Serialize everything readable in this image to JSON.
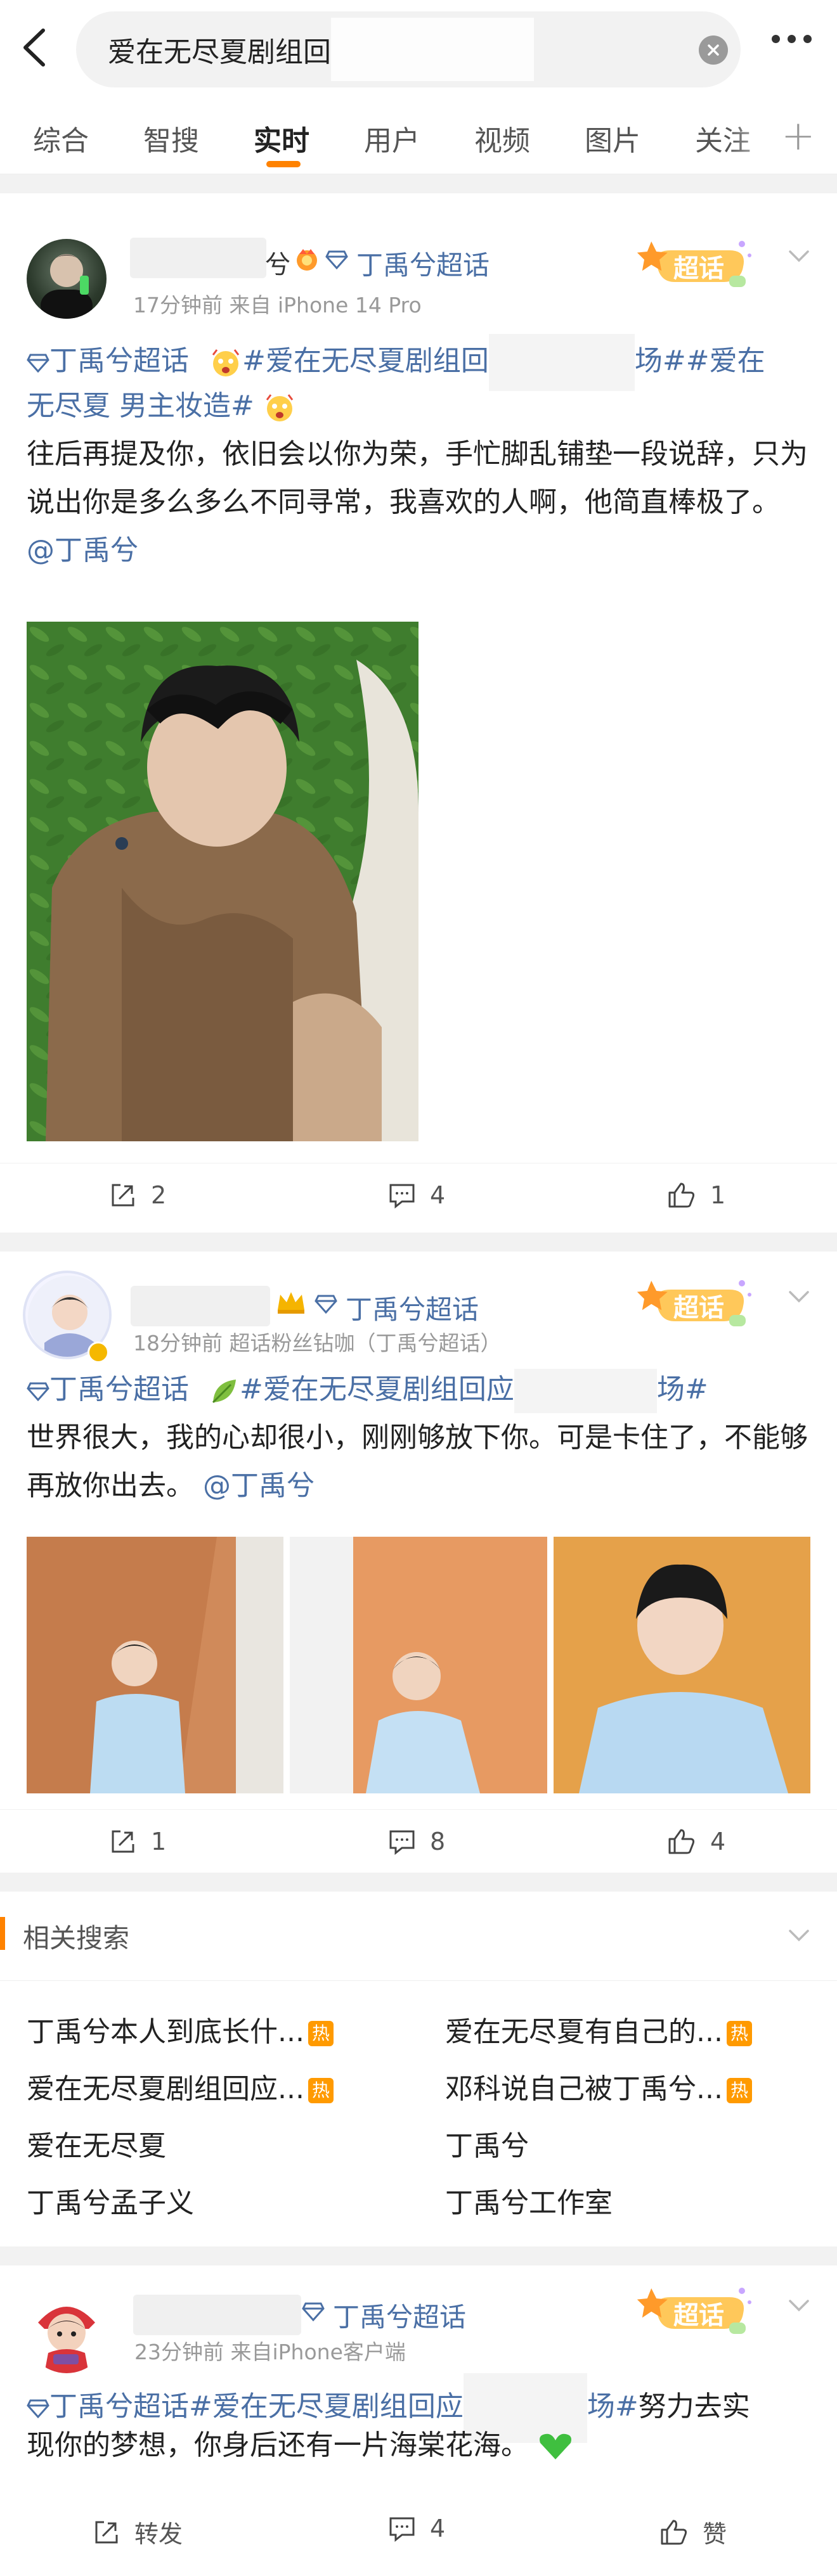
{
  "search": {
    "query": "爱在无尽夏剧组回"
  },
  "tabs": [
    "综合",
    "智搜",
    "实时",
    "用户",
    "视频",
    "图片",
    "关注"
  ],
  "posts": [
    {
      "name_tail": "兮",
      "topic": "丁禹兮超话",
      "meta": "17分钟前  来自 iPhone 14 Pro",
      "badge": "超话",
      "lines": [
        {
          "a": "丁禹兮超话",
          "b": "#爱在无尽夏剧组回",
          "c": "场##爱在"
        },
        {
          "a": "无尽夏 男主妆造#"
        }
      ],
      "text": "往后再提及你，依旧会以你为荣，手忙脚乱铺垫一段说辞，只为说出你是多么多么不同寻常，我喜欢的人啊，他简直棒极了。",
      "mention": "@丁禹兮",
      "actions": {
        "repost": "2",
        "comment": "4",
        "like": "1"
      }
    },
    {
      "topic": "丁禹兮超话",
      "meta": "18分钟前  超话粉丝钻咖（丁禹兮超话）",
      "badge": "超话",
      "line1a": "丁禹兮超话",
      "line1b": "#爱在无尽夏剧组回应",
      "line1c": "场#",
      "text": "世界很大，我的心却很小，刚刚够放下你。可是卡住了，不能够再放你出去。",
      "mention": "@丁禹兮",
      "actions": {
        "repost": "1",
        "comment": "8",
        "like": "4"
      }
    },
    {
      "topic": "丁禹兮超话",
      "meta": "23分钟前  来自iPhone客户端",
      "badge": "超话",
      "line1a": "丁禹兮超话#爱在无尽夏剧组回应",
      "line1b": "场#",
      "line1c": "努力去实",
      "line2": "现你的梦想，你身后还有一片海棠花海。",
      "actions": {
        "repost": "转发",
        "comment": "4",
        "like": "赞"
      }
    }
  ],
  "related": {
    "title": "相关搜索",
    "hot_label": "热",
    "items": [
      {
        "text": "丁禹兮本人到底长什...",
        "hot": true
      },
      {
        "text": "爱在无尽夏有自己的...",
        "hot": true
      },
      {
        "text": "爱在无尽夏剧组回应...",
        "hot": true
      },
      {
        "text": "邓科说自己被丁禹兮...",
        "hot": true
      },
      {
        "text": "爱在无尽夏",
        "hot": false
      },
      {
        "text": "丁禹兮",
        "hot": false
      },
      {
        "text": "丁禹兮孟子义",
        "hot": false
      },
      {
        "text": "丁禹兮工作室",
        "hot": false
      }
    ]
  },
  "colors": {
    "accent": "#ff8200",
    "link": "#4a6fa5",
    "hot": "#ff9a00"
  }
}
